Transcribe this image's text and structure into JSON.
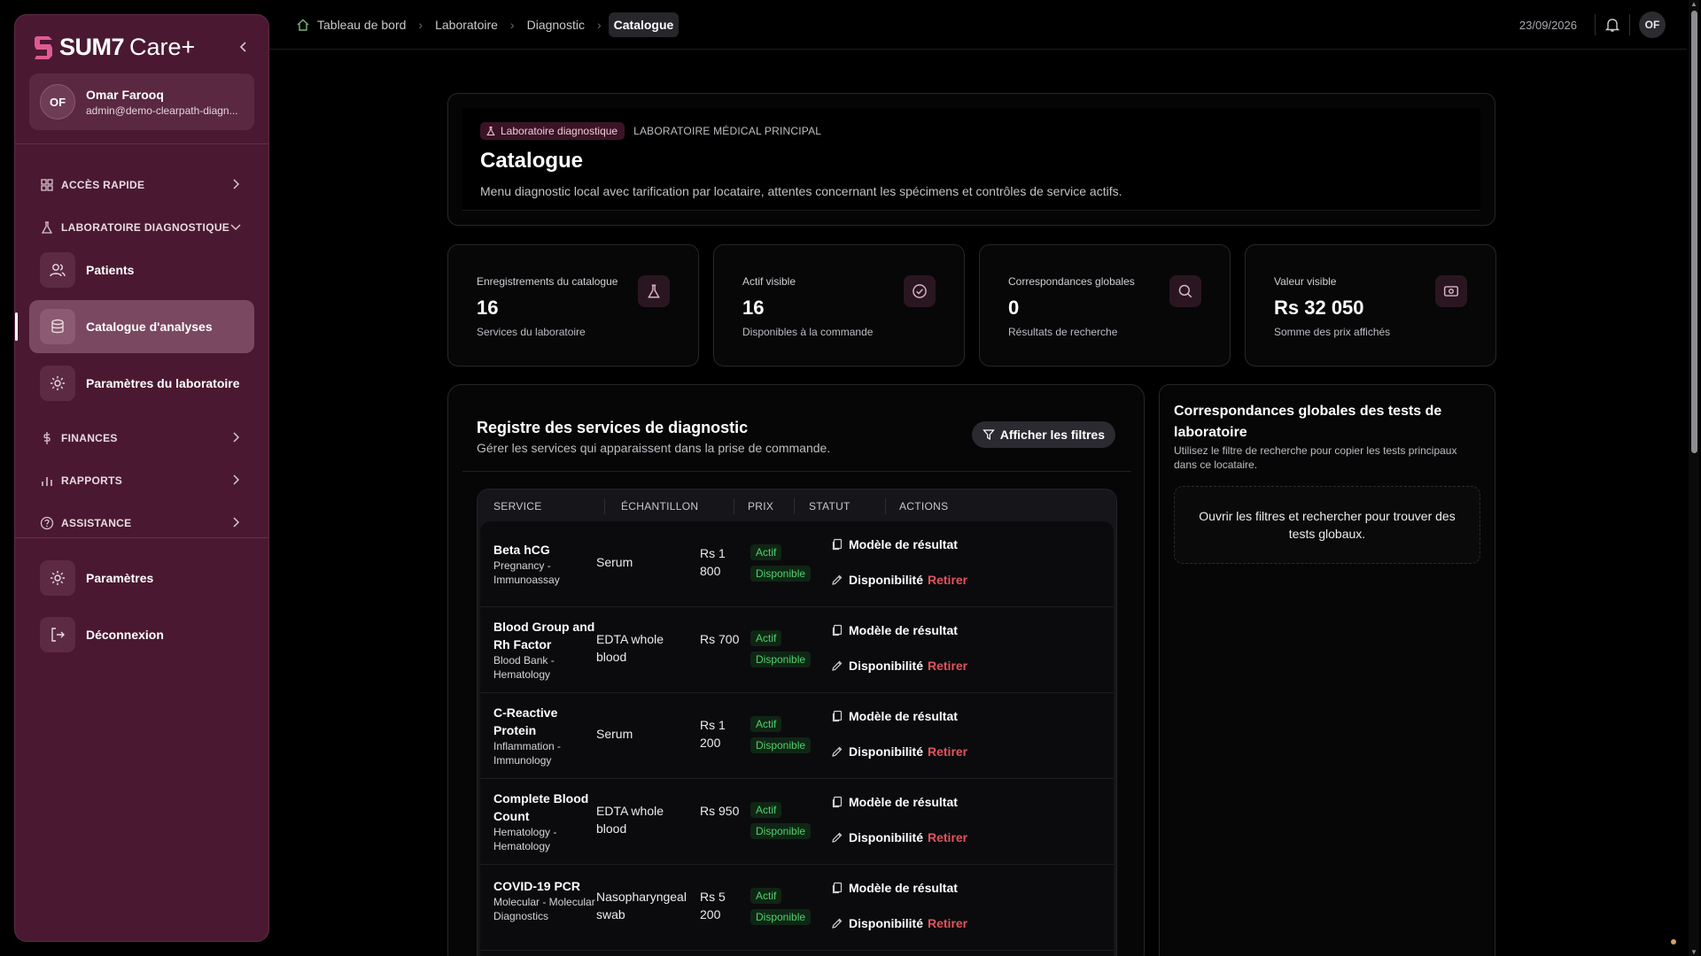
{
  "brand": {
    "name": "SUM7",
    "suffix": "Care+"
  },
  "user": {
    "initials": "OF",
    "name": "Omar Farooq",
    "email": "admin@demo-clearpath-diagn..."
  },
  "sidebar": {
    "sections": {
      "quick": "ACCÈS RAPIDE",
      "lab": "LABORATOIRE DIAGNOSTIQUE",
      "finances": "FINANCES",
      "reports": "RAPPORTS",
      "help": "ASSISTANCE"
    },
    "items": {
      "patients": "Patients",
      "catalog": "Catalogue d'analyses",
      "lab_settings": "Paramètres du laboratoire",
      "settings": "Paramètres",
      "logout": "Déconnexion"
    }
  },
  "topbar": {
    "breadcrumbs": [
      "Tableau de bord",
      "Laboratoire",
      "Diagnostic",
      "Catalogue"
    ],
    "date": "23/09/2026",
    "initials": "OF"
  },
  "header": {
    "chip": "Laboratoire diagnostique",
    "chip_sub": "LABORATOIRE MÉDICAL PRINCIPAL",
    "title": "Catalogue",
    "description": "Menu diagnostic local avec tarification par locataire, attentes concernant les spécimens et contrôles de service actifs."
  },
  "stats": [
    {
      "label": "Enregistrements du catalogue",
      "value": "16",
      "sub": "Services du laboratoire",
      "icon": "flask-icon"
    },
    {
      "label": "Actif visible",
      "value": "16",
      "sub": "Disponibles à la commande",
      "icon": "check-circle-icon"
    },
    {
      "label": "Correspondances globales",
      "value": "0",
      "sub": "Résultats de recherche",
      "icon": "search-icon"
    },
    {
      "label": "Valeur visible",
      "value": "Rs 32 050",
      "sub": "Somme des prix affichés",
      "icon": "money-icon"
    }
  ],
  "registry": {
    "title": "Registre des services de diagnostic",
    "subtitle": "Gérer les services qui apparaissent dans la prise de commande.",
    "filter_button": "Afficher les filtres",
    "columns": [
      "SERVICE",
      "ÉCHANTILLON",
      "PRIX",
      "STATUT",
      "ACTIONS"
    ],
    "status_active": "Actif",
    "status_available": "Disponible",
    "action_template": "Modèle de résultat",
    "action_availability": "Disponibilité",
    "action_remove": "Retirer",
    "rows": [
      {
        "name": "Beta hCG",
        "category": "Pregnancy - Immunoassay",
        "sample": "Serum",
        "price": "Rs 1 800"
      },
      {
        "name": "Blood Group and Rh Factor",
        "category": "Blood Bank - Hematology",
        "sample": "EDTA whole blood",
        "price": "Rs 700"
      },
      {
        "name": "C-Reactive Protein",
        "category": "Inflammation - Immunology",
        "sample": "Serum",
        "price": "Rs 1 200"
      },
      {
        "name": "Complete Blood Count",
        "category": "Hematology - Hematology",
        "sample": "EDTA whole blood",
        "price": "Rs 950"
      },
      {
        "name": "COVID-19 PCR",
        "category": "Molecular - Molecular Diagnostics",
        "sample": "Nasopharyngeal swab",
        "price": "Rs 5 200"
      }
    ]
  },
  "global_matches": {
    "title": "Correspondances globales des tests de laboratoire",
    "subtitle": "Utilisez le filtre de recherche pour copier les tests principaux dans ce locataire.",
    "empty": "Ouvrir les filtres et rechercher pour trouver des tests globaux."
  },
  "colors": {
    "accent": "#4a1931",
    "active_green": "#4fd16a",
    "danger": "#e0545d"
  }
}
